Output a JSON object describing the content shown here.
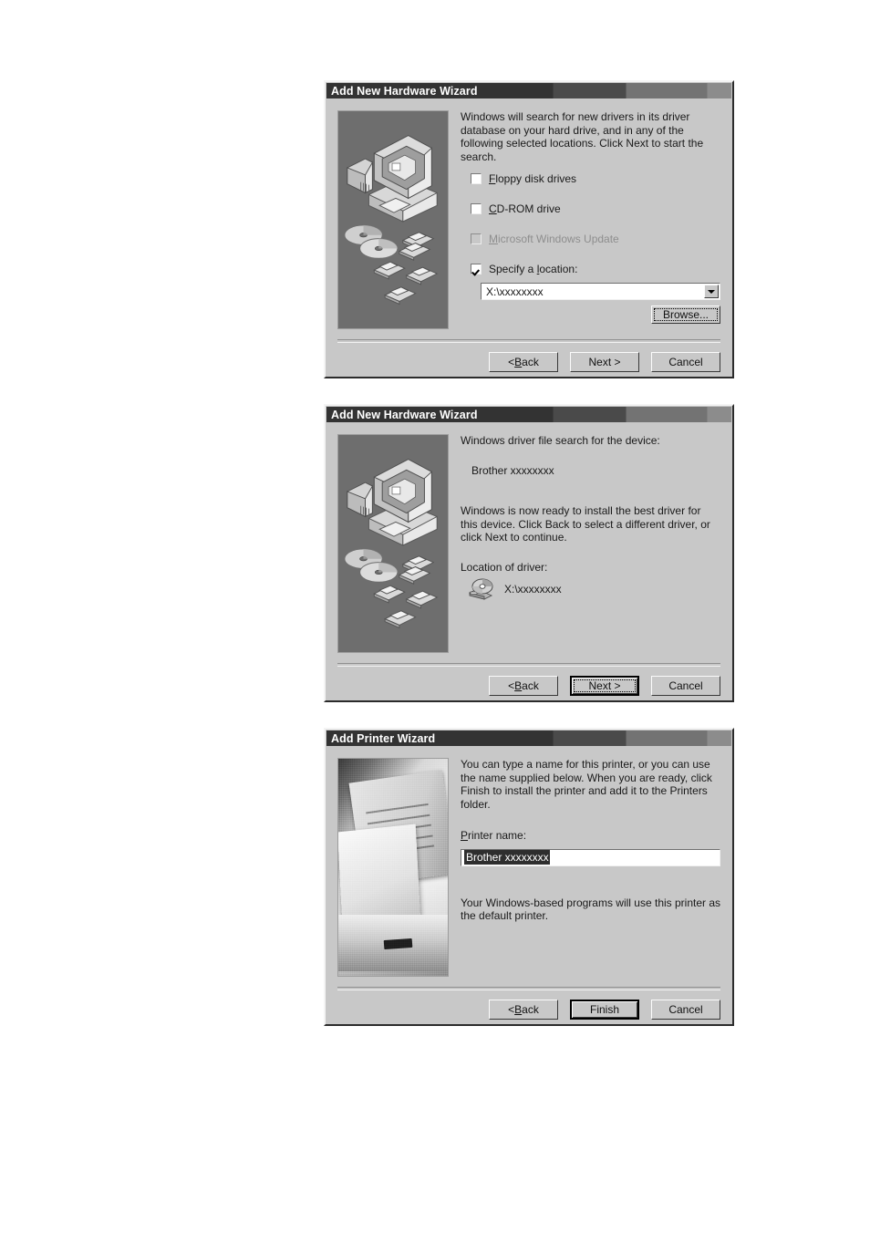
{
  "dialogs": [
    {
      "title": "Add New Hardware Wizard",
      "illustration": "computer-media-illustration",
      "intro": "Windows will search for new drivers in its driver database on your hard drive, and in any of the following selected locations. Click Next to start the search.",
      "checkboxes": [
        {
          "label": "Floppy disk drives",
          "accel": "F",
          "checked": false,
          "disabled": false
        },
        {
          "label": "CD-ROM drive",
          "accel": "C",
          "checked": false,
          "disabled": false
        },
        {
          "label": "Microsoft Windows Update",
          "accel": "M",
          "checked": false,
          "disabled": true
        },
        {
          "label": "Specify a location:",
          "accel": "l",
          "checked": true,
          "disabled": false
        }
      ],
      "combo": {
        "value": "X:\\xxxxxxxx",
        "icon": "chevron-down-icon"
      },
      "browse_button": "Browse...",
      "buttons": [
        {
          "label": "< Back",
          "accel": "B",
          "default": false,
          "focused": false
        },
        {
          "label": "Next >",
          "default": false,
          "focused": false
        },
        {
          "label": "Cancel",
          "default": false,
          "focused": false
        }
      ]
    },
    {
      "title": "Add New Hardware Wizard",
      "illustration": "computer-media-illustration",
      "search_heading": "Windows driver file search for the device:",
      "device_name": "Brother  xxxxxxxx",
      "ready_text": "Windows is now ready to install the best driver for this device. Click Back to select a different driver, or click Next to continue.",
      "location_heading": "Location of driver:",
      "location_icon": "cdrom-drive-icon",
      "location_value": "X:\\xxxxxxxx",
      "buttons": [
        {
          "label": "< Back",
          "accel": "B",
          "default": false,
          "focused": false
        },
        {
          "label": "Next >",
          "default": true,
          "focused": true
        },
        {
          "label": "Cancel",
          "default": false,
          "focused": false
        }
      ]
    },
    {
      "title": "Add Printer Wizard",
      "illustration": "printer-photo",
      "intro": "You can type a name for this printer, or you can use the name supplied below. When you are ready, click Finish to install the printer and add it to the Printers folder.",
      "field_label": "Printer name:",
      "field_accel": "P",
      "field_value": "Brother  xxxxxxxx",
      "field_selected": true,
      "footnote": "Your Windows-based programs will use this printer as the default printer.",
      "buttons": [
        {
          "label": "< Back",
          "accel": "B",
          "default": false,
          "focused": false
        },
        {
          "label": "Finish",
          "default": true,
          "focused": false
        },
        {
          "label": "Cancel",
          "default": false,
          "focused": false
        }
      ]
    }
  ],
  "colors": {
    "dialog_face": "#c8c8c8",
    "titlebar_dark": "#333333",
    "illustration_bg": "#6e6e6e",
    "field_bg": "#ffffff",
    "selection_bg": "#2e2e2e",
    "text": "#1a1a1a",
    "disabled_text": "#8e8e8e"
  }
}
